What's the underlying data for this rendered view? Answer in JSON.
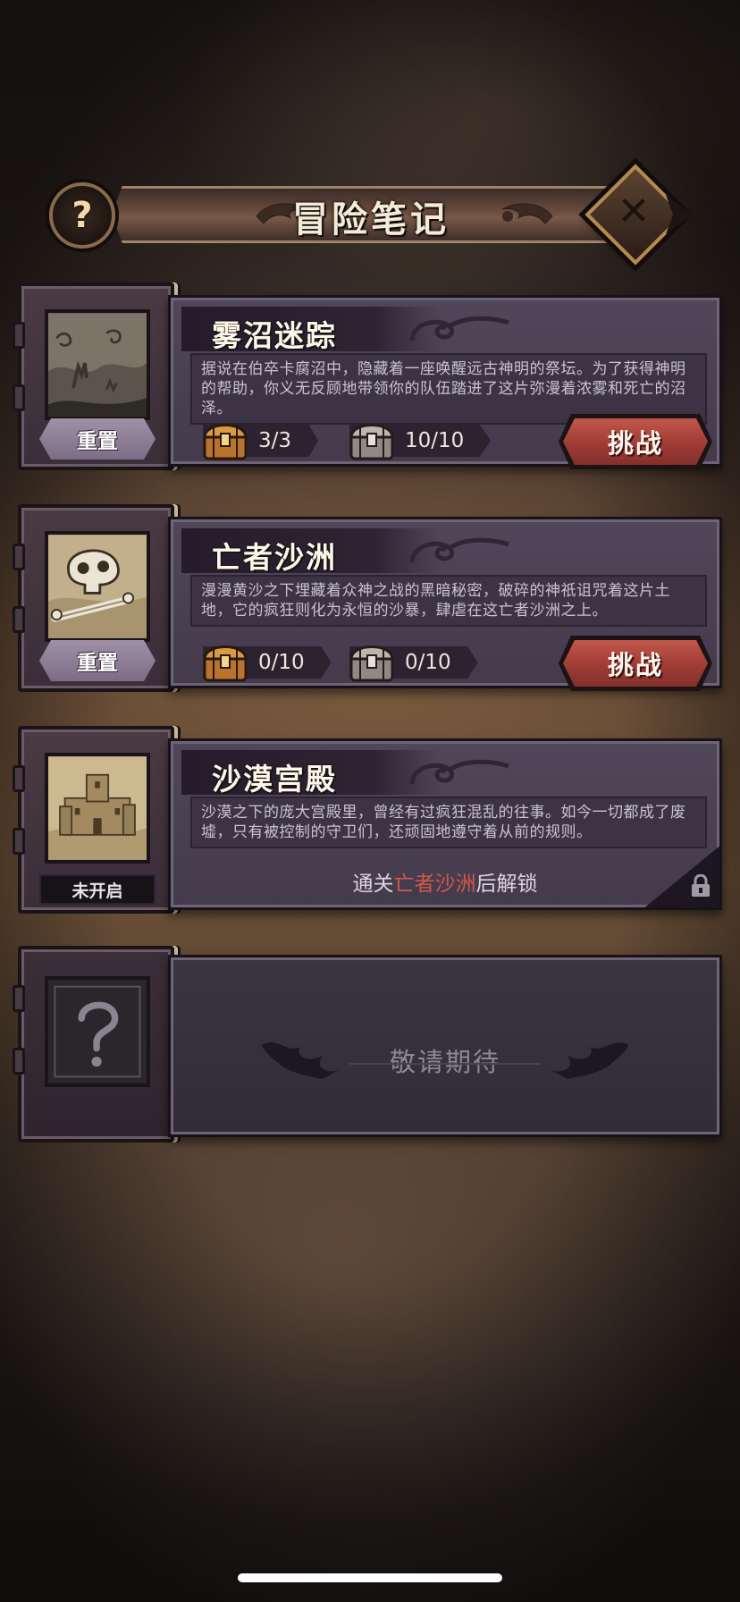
{
  "header": {
    "title": "冒险笔记",
    "help_label": "?",
    "close_label": "✕"
  },
  "adventures": [
    {
      "title": "雾沼迷踪",
      "description": "据说在伯卒卡腐沼中，隐藏着一座唤醒远古神明的祭坛。为了获得神明的帮助，你义无反顾地带领你的队伍踏进了这片弥漫着浓雾和死亡的沼泽。",
      "gold_chest": "3/3",
      "silver_chest": "10/10",
      "reset_label": "重置",
      "challenge_label": "挑战",
      "thumbnail": "swamp-scene"
    },
    {
      "title": "亡者沙洲",
      "description": "漫漫黄沙之下埋藏着众神之战的黑暗秘密，破碎的神祇诅咒着这片土地，它的疯狂则化为永恒的沙暴，肆虐在这亡者沙洲之上。",
      "gold_chest": "0/10",
      "silver_chest": "0/10",
      "reset_label": "重置",
      "challenge_label": "挑战",
      "thumbnail": "skull-desert"
    },
    {
      "title": "沙漠宫殿",
      "description": "沙漠之下的庞大宫殿里，曾经有过疯狂混乱的往事。如今一切都成了废墟，只有被控制的守卫们，还顽固地遵守着从前的规则。",
      "status_label": "未开启",
      "unlock_prefix": "通关",
      "unlock_highlight": "亡者沙洲",
      "unlock_suffix": "后解锁",
      "thumbnail": "desert-palace"
    }
  ],
  "coming_soon": {
    "text": "敬请期待",
    "thumbnail_icon": "question-mark-icon"
  },
  "colors": {
    "accent_red": "#d6564a",
    "challenge_button": "#a8413a",
    "reset_button": "#8e7e97",
    "panel": "#4a4253"
  }
}
